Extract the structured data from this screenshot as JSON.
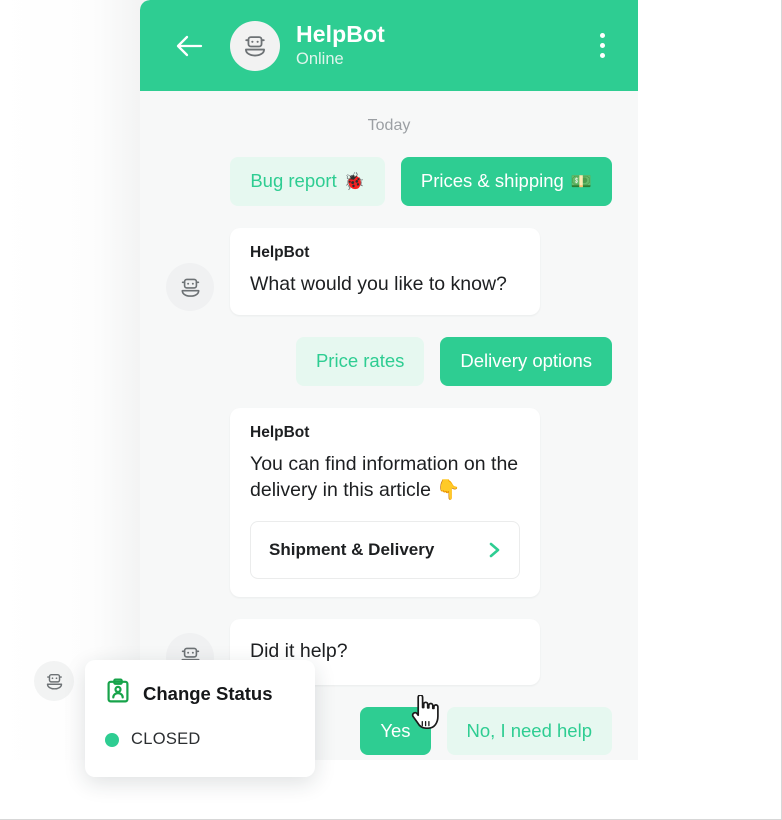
{
  "header": {
    "title": "HelpBot",
    "status": "Online",
    "back_icon": "arrow-left-icon",
    "menu_icon": "more-vertical-icon",
    "avatar_icon": "robot-avatar-icon",
    "background_color": "#2ecd92"
  },
  "chat": {
    "day_divider": "Today",
    "background_color": "#f7f8f8",
    "quick_replies_1": [
      {
        "label": "Bug report",
        "emoji": "🐞",
        "style": "light"
      },
      {
        "label": "Prices & shipping",
        "emoji": "💵",
        "style": "solid"
      }
    ],
    "message_1": {
      "sender": "HelpBot",
      "text": "What would you like to know?"
    },
    "quick_replies_2": [
      {
        "label": "Price rates",
        "emoji": "",
        "style": "light"
      },
      {
        "label": "Delivery options",
        "emoji": "",
        "style": "solid"
      }
    ],
    "message_2": {
      "sender": "HelpBot",
      "text": "You can find information on the delivery in this article 👇",
      "article": {
        "title": "Shipment & Delivery",
        "chevron_icon": "chevron-right-icon"
      }
    },
    "message_3": {
      "text": "Did it help?"
    },
    "feedback_replies": [
      {
        "label": "Yes",
        "style": "solid"
      },
      {
        "label": "No, I need help",
        "style": "light"
      }
    ]
  },
  "status_popup": {
    "icon": "id-badge-icon",
    "title": "Change Status",
    "status_value": "CLOSED",
    "status_color": "#2ecd92"
  },
  "cursor": {
    "icon": "pointing-hand-cursor"
  }
}
